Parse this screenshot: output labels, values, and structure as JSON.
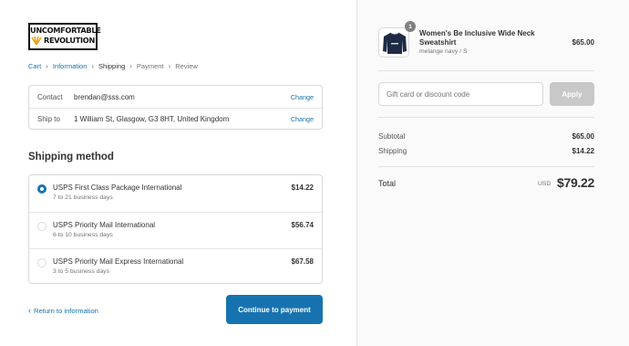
{
  "brand": {
    "logo_line1": "UNCOMFORTABLE",
    "logo_line2": "REVOLUTION"
  },
  "breadcrumb": [
    {
      "label": "Cart",
      "state": "link"
    },
    {
      "label": "Information",
      "state": "link"
    },
    {
      "label": "Shipping",
      "state": "current"
    },
    {
      "label": "Payment",
      "state": "future"
    },
    {
      "label": "Review",
      "state": "future"
    }
  ],
  "review": {
    "contact": {
      "label": "Contact",
      "value": "brendan@sss.com",
      "action": "Change"
    },
    "ship_to": {
      "label": "Ship to",
      "value": "1 William St, Glasgow, G3 8HT, United Kingdom",
      "action": "Change"
    }
  },
  "shipping": {
    "title": "Shipping method",
    "options": [
      {
        "name": "USPS First Class Package International",
        "days": "7 to 21 business days",
        "price": "$14.22",
        "selected": true
      },
      {
        "name": "USPS Priority Mail International",
        "days": "6 to 10 business days",
        "price": "$56.74",
        "selected": false
      },
      {
        "name": "USPS Priority Mail Express International",
        "days": "3 to 5 business days",
        "price": "$67.58",
        "selected": false
      }
    ]
  },
  "nav": {
    "return_label": "Return to information",
    "continue_label": "Continue to payment"
  },
  "product": {
    "quantity": "1",
    "name": "Women's Be Inclusive Wide Neck Sweatshirt",
    "variant": "melange navy / S",
    "price": "$65.00",
    "color": "#1f2a44"
  },
  "discount": {
    "placeholder": "Gift card or discount code",
    "apply_label": "Apply"
  },
  "summary": {
    "subtotal_label": "Subtotal",
    "subtotal": "$65.00",
    "shipping_label": "Shipping",
    "shipping": "$14.22",
    "total_label": "Total",
    "currency": "USD",
    "total": "$79.22"
  },
  "colors": {
    "accent": "#1773b0",
    "button_disabled": "#c8c8c8"
  }
}
